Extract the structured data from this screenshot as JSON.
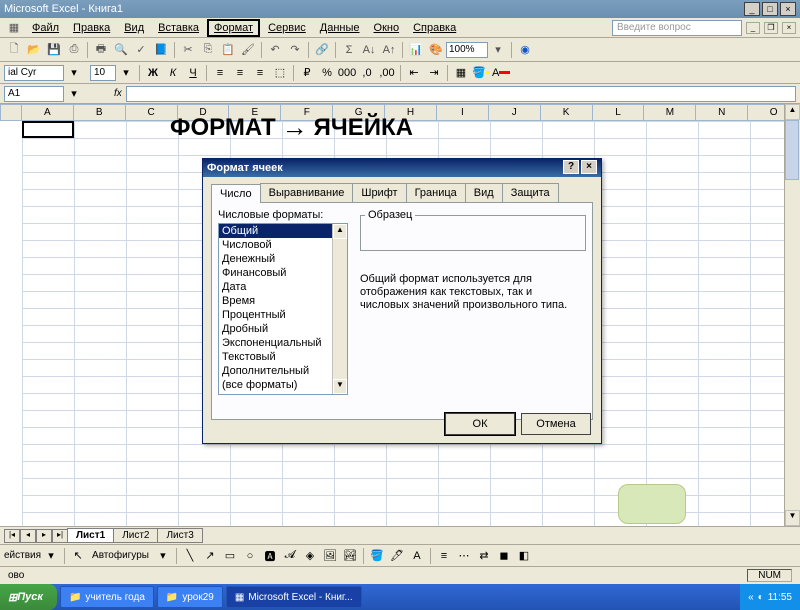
{
  "title": "Microsoft Excel - Книга1",
  "menu": {
    "file": "Файл",
    "edit": "Правка",
    "view": "Вид",
    "insert": "Вставка",
    "format": "Формат",
    "tools": "Сервис",
    "data": "Данные",
    "window": "Окно",
    "help": "Справка",
    "question": "Введите вопрос"
  },
  "toolbar": {
    "zoom": "100%"
  },
  "format": {
    "font": "ial Cyr",
    "size": "10"
  },
  "name": {
    "cell": "A1",
    "fx": "fx"
  },
  "cols": [
    "A",
    "B",
    "C",
    "D",
    "E",
    "F",
    "G",
    "H",
    "I",
    "J",
    "K",
    "L",
    "M",
    "N",
    "O"
  ],
  "annotation": {
    "left": "ФОРМАТ",
    "right": "ЯЧЕЙКА"
  },
  "dialog": {
    "title": "Формат ячеек",
    "tabs": [
      "Число",
      "Выравнивание",
      "Шрифт",
      "Граница",
      "Вид",
      "Защита"
    ],
    "list_label": "Числовые форматы:",
    "items": [
      "Общий",
      "Числовой",
      "Денежный",
      "Финансовый",
      "Дата",
      "Время",
      "Процентный",
      "Дробный",
      "Экспоненциальный",
      "Текстовый",
      "Дополнительный",
      "(все форматы)"
    ],
    "sample": "Образец",
    "desc": "Общий формат используется для отображения как текстовых, так и числовых значений произвольного типа.",
    "ok": "ОК",
    "cancel": "Отмена"
  },
  "sheets": {
    "s1": "Лист1",
    "s2": "Лист2",
    "s3": "Лист3"
  },
  "draw": {
    "actions": "ействия",
    "autoshapes": "Автофигуры"
  },
  "status": {
    "ready": "ово",
    "num": "NUM"
  },
  "taskbar": {
    "start": "Пуск",
    "t1": "учитель года",
    "t2": "урок29",
    "t3": "Microsoft Excel - Книг...",
    "time": "11:55"
  }
}
